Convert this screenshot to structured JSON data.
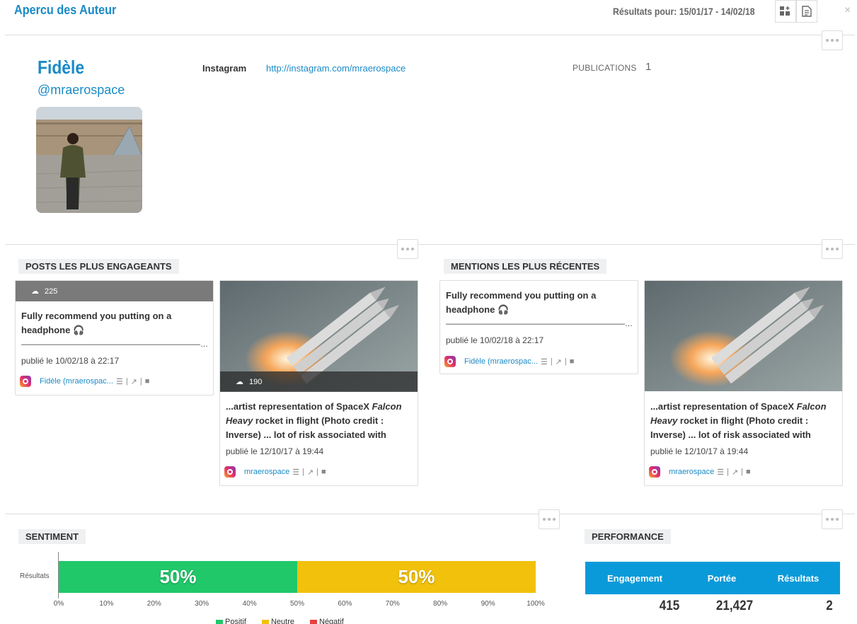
{
  "header": {
    "title": "Apercu des Auteur",
    "results_range": "Résultats pour: 15/01/17 - 14/02/18",
    "close_glyph": "×"
  },
  "author": {
    "name": "Fidèle",
    "handle": "@mraerospace",
    "network_label": "Instagram",
    "network_url": "http://instagram.com/mraerospace",
    "publications_label": "PUBLICATIONS",
    "publications_value": "1"
  },
  "engaging": {
    "label": "POSTS LES PLUS ENGAGEANTS",
    "posts": [
      {
        "metric": "225",
        "text_line1": "Fully recommend you putting on a",
        "text_line2": "headphone 🎧",
        "text_line3": "———————————————————————…",
        "date": "publié le 10/02/18 à 22:17",
        "author": "Fidèle (mraerospac..."
      },
      {
        "metric": "190",
        "text_a": "...artist representation of SpaceX ",
        "text_b": "Falcon",
        "text_c": "Heavy",
        "text_d": " rocket in flight (Photo credit :",
        "text_line3": "Inverse) ... lot of risk associated with",
        "date": "publié le 12/10/17 à 19:44",
        "author": "mraerospace"
      }
    ]
  },
  "mentions": {
    "label": "MENTIONS LES PLUS RÉCENTES",
    "posts": [
      {
        "text_line1": "Fully recommend you putting on a",
        "text_line2": "headphone 🎧",
        "text_line3": "———————————————————————…",
        "date": "publié le 10/02/18 à 22:17",
        "author": "Fidèle (mraerospac..."
      },
      {
        "text_a": "...artist representation of SpaceX ",
        "text_b": "Falcon",
        "text_c": "Heavy",
        "text_d": " rocket in flight (Photo credit :",
        "text_line3": "Inverse) ... lot of risk associated with",
        "date": "publié le 12/10/17 à 19:44",
        "author": "mraerospace"
      }
    ]
  },
  "sentiment": {
    "label": "SENTIMENT",
    "legend": [
      "Positif",
      "Neutre",
      "Négatif"
    ],
    "colors": {
      "positif": "#20c86a",
      "neutre": "#f1c10c",
      "negatif": "#e84040"
    }
  },
  "chart_data": {
    "type": "bar",
    "orientation": "horizontal-stacked",
    "categories": [
      "Résultats"
    ],
    "series": [
      {
        "name": "Positif",
        "values": [
          50
        ]
      },
      {
        "name": "Neutre",
        "values": [
          50
        ]
      },
      {
        "name": "Négatif",
        "values": [
          0
        ]
      }
    ],
    "data_labels": [
      "50%",
      "50%"
    ],
    "xlim": [
      0,
      100
    ],
    "x_ticks": [
      "0%",
      "10%",
      "20%",
      "30%",
      "40%",
      "50%",
      "60%",
      "70%",
      "80%",
      "90%",
      "100%"
    ],
    "legend_position": "bottom"
  },
  "performance": {
    "label": "PERFORMANCE",
    "columns": [
      "Engagement",
      "Portée",
      "Résultats"
    ],
    "values": [
      "415",
      "21,427",
      "2"
    ],
    "header_color": "#0a9ad9"
  }
}
